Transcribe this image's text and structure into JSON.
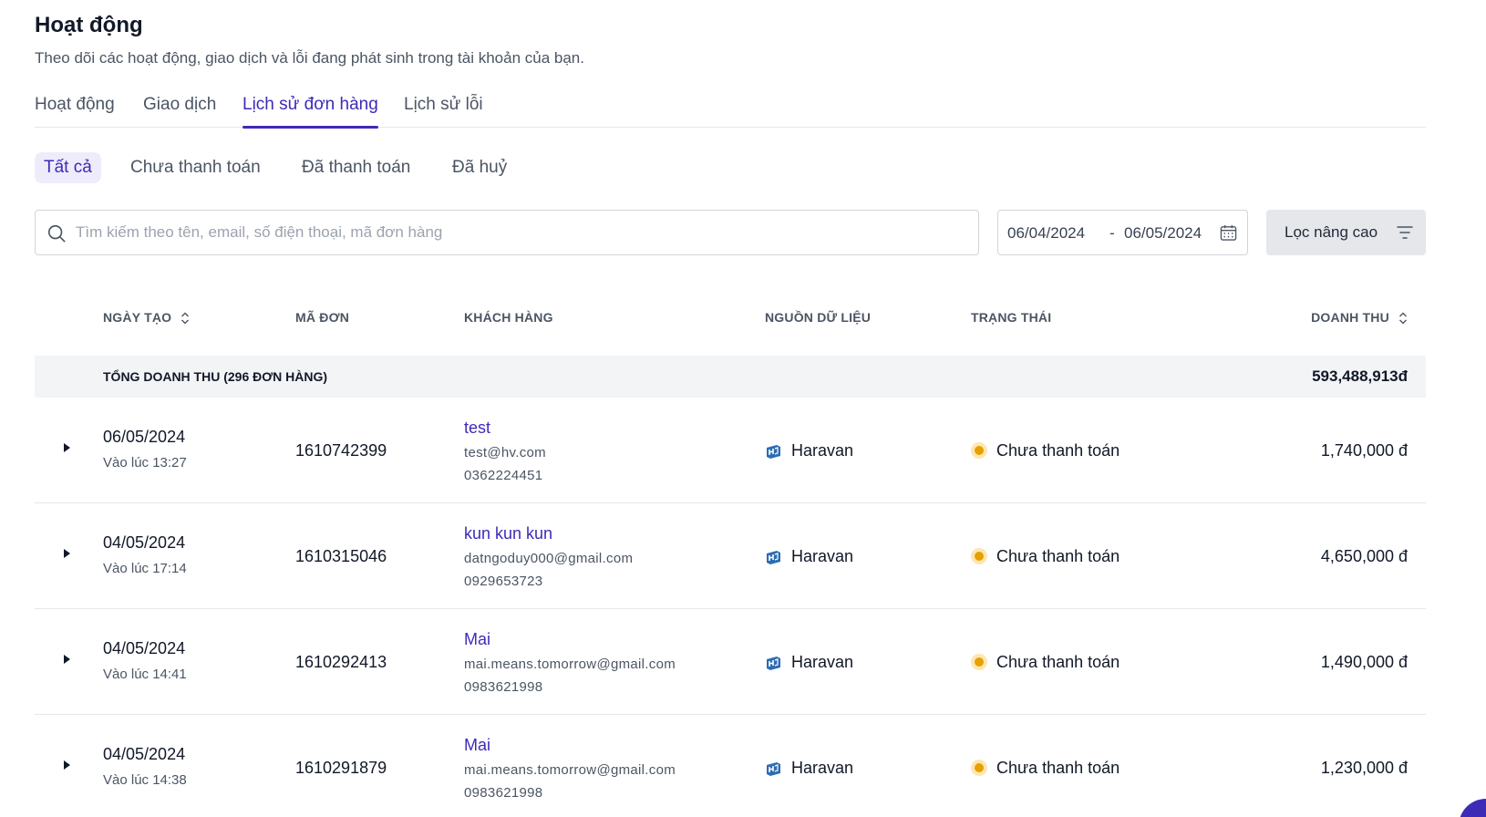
{
  "page": {
    "title": "Hoạt động",
    "subtitle": "Theo dõi các hoạt động, giao dịch và lỗi đang phát sinh trong tài khoản của bạn."
  },
  "tabs": [
    {
      "label": "Hoạt động",
      "active": false
    },
    {
      "label": "Giao dịch",
      "active": false
    },
    {
      "label": "Lịch sử đơn hàng",
      "active": true
    },
    {
      "label": "Lịch sử lỗi",
      "active": false
    }
  ],
  "subtabs": [
    {
      "label": "Tất cả",
      "active": true
    },
    {
      "label": "Chưa thanh toán",
      "active": false
    },
    {
      "label": "Đã thanh toán",
      "active": false
    },
    {
      "label": "Đã huỷ",
      "active": false
    }
  ],
  "search": {
    "placeholder": "Tìm kiếm theo tên, email, số điện thoại, mã đơn hàng",
    "value": "",
    "icon": "search-icon"
  },
  "date_range": {
    "from": "06/04/2024",
    "separator": "-",
    "to": "06/05/2024",
    "icon": "calendar-icon"
  },
  "filter": {
    "label": "Lọc nâng cao",
    "icon": "filter-icon"
  },
  "table": {
    "headers": {
      "date": "NGÀY TẠO",
      "code": "MÃ ĐƠN",
      "customer": "KHÁCH HÀNG",
      "source": "NGUỒN DỮ LIỆU",
      "status": "TRẠNG THÁI",
      "revenue": "DOANH THU"
    },
    "total": {
      "label": "TỔNG DOANH THU (296 ĐƠN HÀNG)",
      "value": "593,488,913đ"
    },
    "rows": [
      {
        "date": "06/05/2024",
        "time": "Vào lúc 13:27",
        "code": "1610742399",
        "customer_name": "test",
        "customer_email": "test@hv.com",
        "customer_phone": "0362224451",
        "source": "Haravan",
        "status": "Chưa thanh toán",
        "revenue": "1,740,000 đ"
      },
      {
        "date": "04/05/2024",
        "time": "Vào lúc 17:14",
        "code": "1610315046",
        "customer_name": "kun kun kun",
        "customer_email": "datngoduy000@gmail.com",
        "customer_phone": "0929653723",
        "source": "Haravan",
        "status": "Chưa thanh toán",
        "revenue": "4,650,000 đ"
      },
      {
        "date": "04/05/2024",
        "time": "Vào lúc 14:41",
        "code": "1610292413",
        "customer_name": "Mai",
        "customer_email": "mai.means.tomorrow@gmail.com",
        "customer_phone": "0983621998",
        "source": "Haravan",
        "status": "Chưa thanh toán",
        "revenue": "1,490,000 đ"
      },
      {
        "date": "04/05/2024",
        "time": "Vào lúc 14:38",
        "code": "1610291879",
        "customer_name": "Mai",
        "customer_email": "mai.means.tomorrow@gmail.com",
        "customer_phone": "0983621998",
        "source": "Haravan",
        "status": "Chưa thanh toán",
        "revenue": "1,230,000 đ"
      }
    ]
  },
  "colors": {
    "accent": "#3d2bb8",
    "status_pending": "#e6a100",
    "total_row_bg": "#f3f4f6"
  }
}
